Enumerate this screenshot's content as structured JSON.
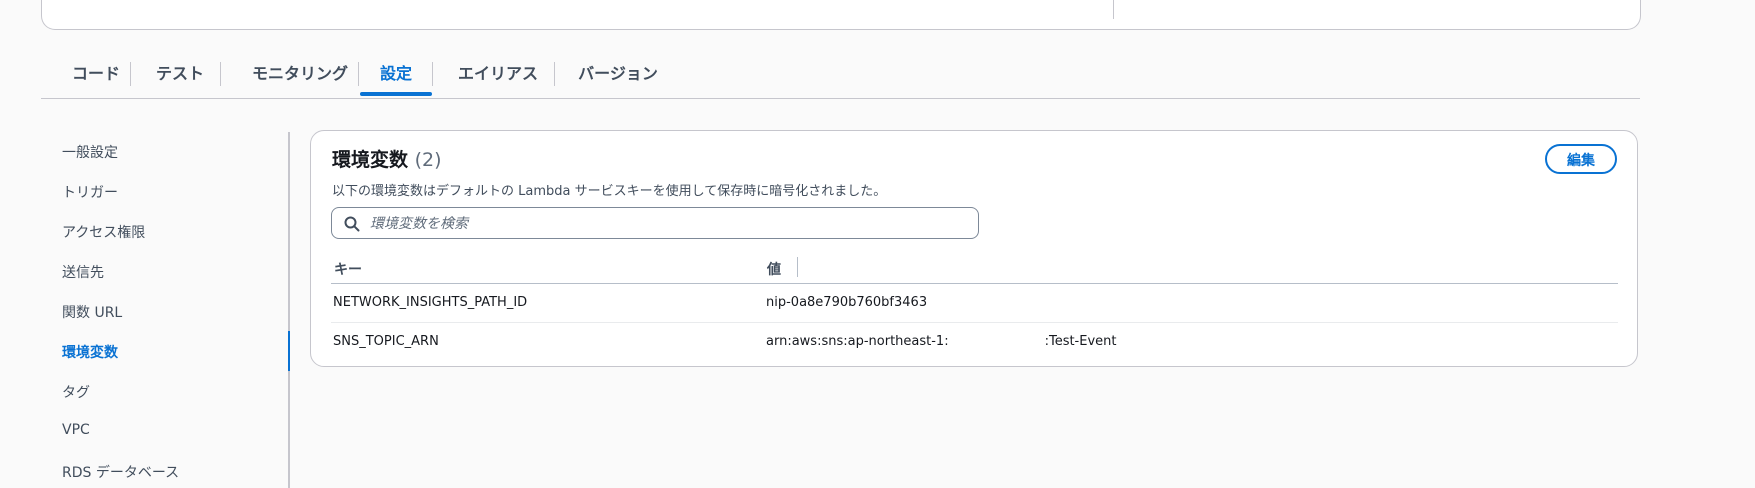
{
  "tabs": [
    {
      "label": "コード",
      "active": false
    },
    {
      "label": "テスト",
      "active": false
    },
    {
      "label": "モニタリング",
      "active": false
    },
    {
      "label": "設定",
      "active": true
    },
    {
      "label": "エイリアス",
      "active": false
    },
    {
      "label": "バージョン",
      "active": false
    }
  ],
  "sidenav": {
    "items": [
      "一般設定",
      "トリガー",
      "アクセス権限",
      "送信先",
      "関数 URL",
      "環境変数",
      "タグ",
      "VPC",
      "RDS データベース"
    ],
    "active_index": 5
  },
  "env_panel": {
    "title": "環境変数",
    "count": "(2)",
    "description": "以下の環境変数はデフォルトの Lambda サービスキーを使用して保存時に暗号化されました。",
    "edit_label": "編集",
    "search_placeholder": "環境変数を検索",
    "columns": {
      "key": "キー",
      "value": "値"
    },
    "rows": [
      {
        "key": "NETWORK_INSIGHTS_PATH_ID",
        "value": "nip-0a8e790b760bf3463"
      },
      {
        "key": "SNS_TOPIC_ARN",
        "value_prefix": "arn:aws:sns:ap-northeast-1:",
        "value_suffix": ":Test-Event"
      }
    ]
  },
  "colors": {
    "accent": "#0972d3",
    "text": "#16191f",
    "muted": "#414d5c",
    "border": "#c6c6cd"
  },
  "icons": {
    "search": "search-icon"
  }
}
